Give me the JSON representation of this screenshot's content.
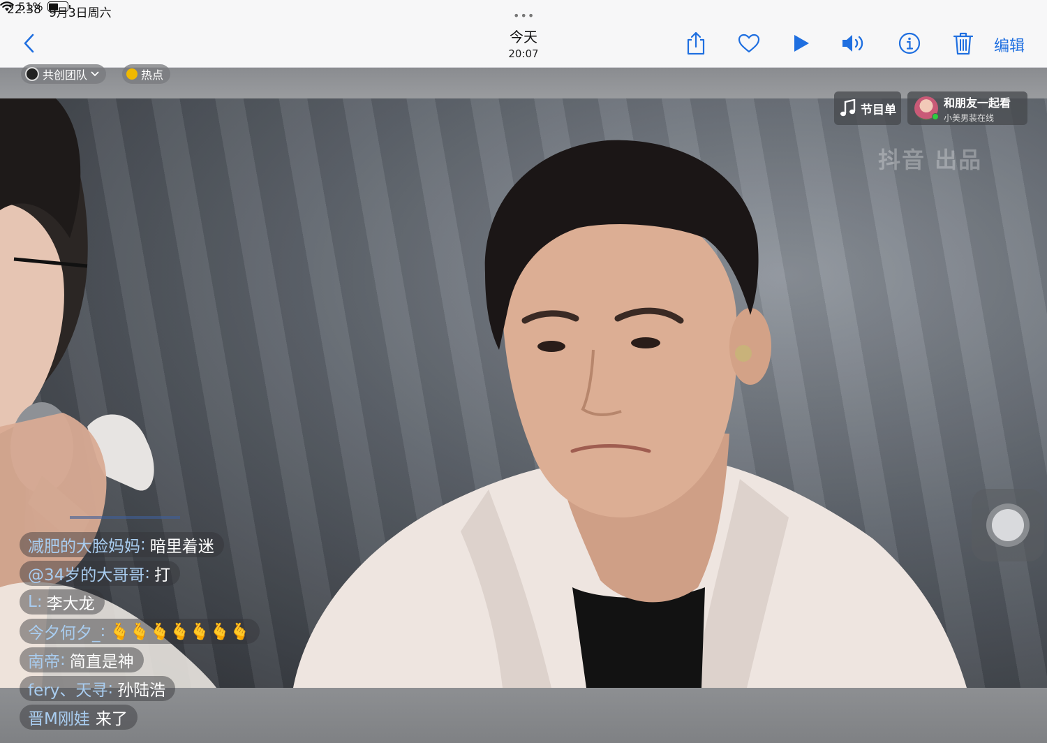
{
  "status_bar": {
    "time": "22:38",
    "date": "9月3日周六",
    "battery_text": "51%",
    "battery_level": 0.51
  },
  "toolbar": {
    "dots": "•••",
    "title": "今天",
    "subtitle": "20:07",
    "edit_label": "编辑",
    "accent_color": "#1f6fe0",
    "icons": [
      "chevron-left-icon",
      "share-icon",
      "heart-icon",
      "play-icon",
      "speaker-icon",
      "info-icon",
      "trash-icon"
    ]
  },
  "video": {
    "team_label": "共创团队",
    "hot_label": "热点",
    "playlist_label": "节目单",
    "watch_together_title": "和朋友一起看",
    "watch_together_sub": "小美男装在线",
    "watermark": "抖音 出品",
    "comments": [
      {
        "user": "减肥的大脸妈妈",
        "sep": ":",
        "text": "暗里着迷"
      },
      {
        "user": "@34岁的大哥哥",
        "sep": ":",
        "text": "打"
      },
      {
        "user": "L",
        "sep": ":",
        "text": "李大龙"
      },
      {
        "user": "今夕何夕_",
        "sep": ":",
        "text": "🫰🫰🫰🫰🫰🫰🫰"
      },
      {
        "user": "南帝",
        "sep": ":",
        "text": "简直是神"
      },
      {
        "user": "fery、天寻",
        "sep": ":",
        "text": "孙陆浩"
      },
      {
        "user": "晋M刚娃",
        "sep": "",
        "text": "",
        "join": "来了"
      }
    ]
  }
}
